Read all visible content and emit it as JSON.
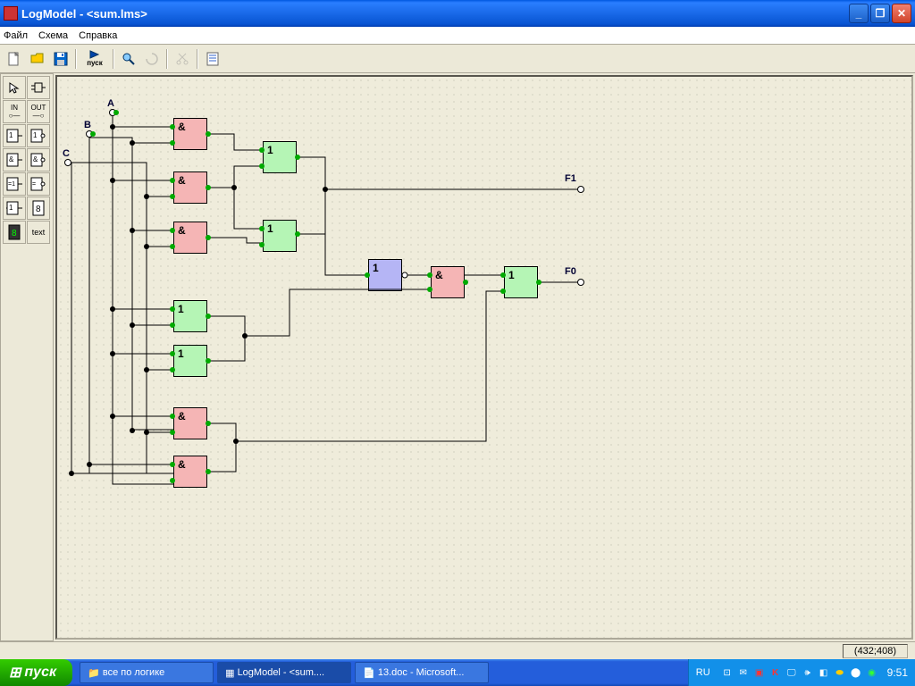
{
  "title": "LogModel - <sum.lms>",
  "menu": {
    "file": "Файл",
    "scheme": "Схема",
    "help": "Справка"
  },
  "toolbar": {
    "run_label": "пуск"
  },
  "toolbox": {
    "in": "IN",
    "out": "OUT",
    "text": "text"
  },
  "inputs": {
    "a": "A",
    "b": "B",
    "c": "C"
  },
  "outputs": {
    "f1": "F1",
    "f0": "F0"
  },
  "gate_labels": {
    "and": "&",
    "or": "1",
    "not": "1"
  },
  "status": {
    "coords": "(432;408)"
  },
  "taskbar": {
    "start": "пуск",
    "lang": "RU",
    "clock": "9:51",
    "tasks": [
      {
        "label": "все по логике",
        "icon": "📁"
      },
      {
        "label": "LogModel - <sum....",
        "icon": "▦",
        "active": true
      },
      {
        "label": "13.doc - Microsoft...",
        "icon": "📄"
      }
    ]
  }
}
